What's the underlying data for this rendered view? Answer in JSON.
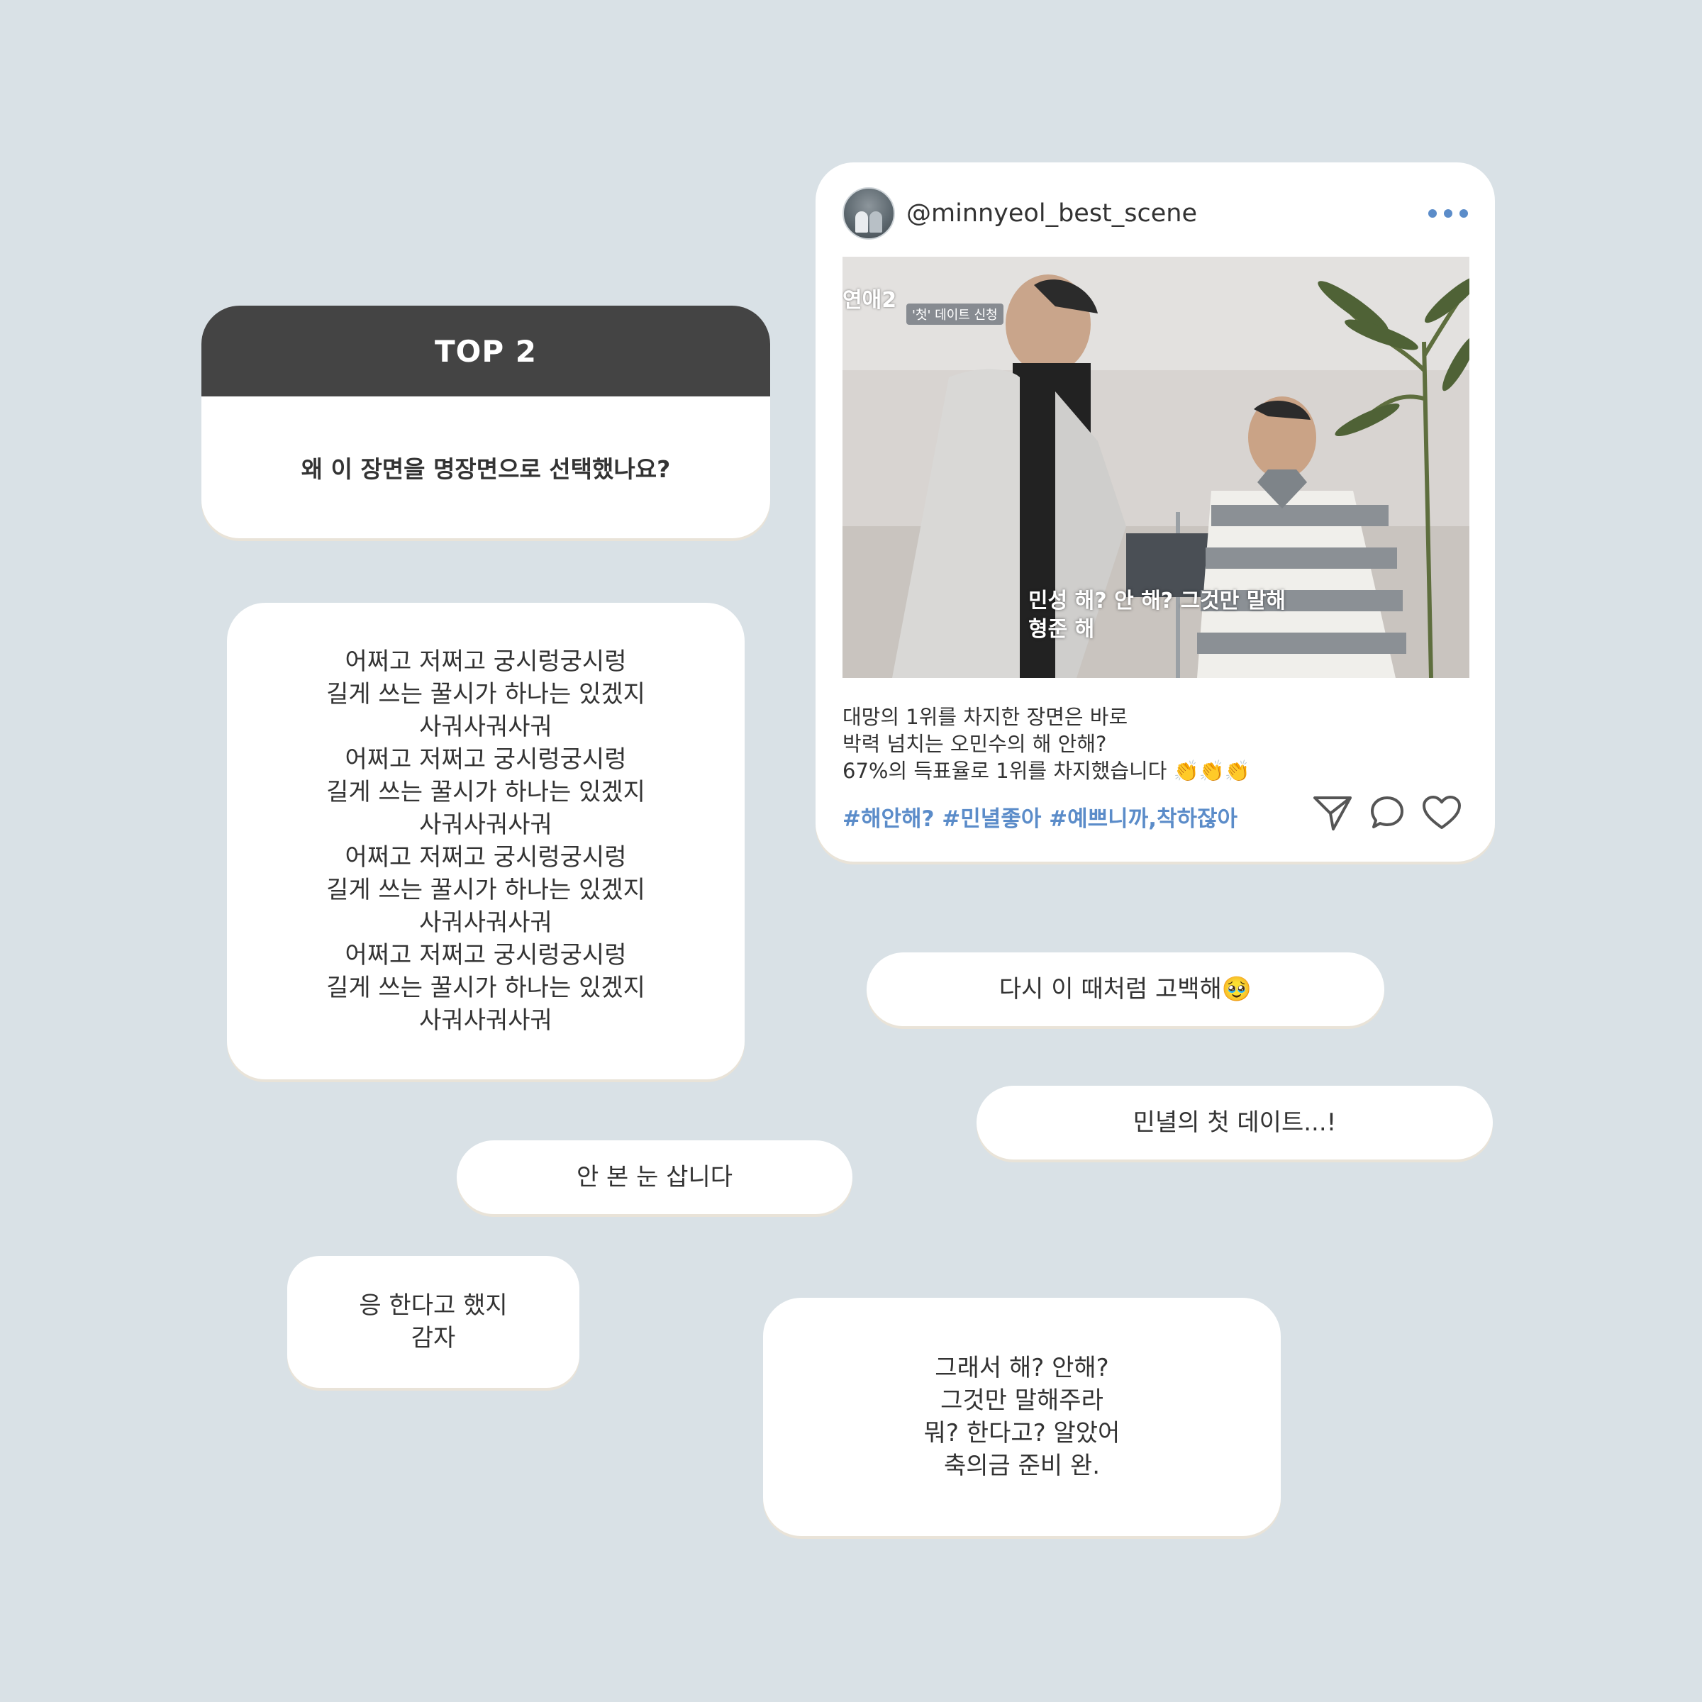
{
  "question_card": {
    "header": "TOP 2",
    "question": "왜 이 장면을 명장면으로 선택했나요?"
  },
  "post": {
    "username": "@minnyeol_best_scene",
    "more_icon": "more-dots-icon",
    "image": {
      "show_logo": "연애2",
      "show_tag": "'첫' 데이트 신청",
      "subtitle_line1": "민성 해? 안 해? 그것만 말해",
      "subtitle_line2": "형준 해"
    },
    "caption": [
      "대망의 1위를 차지한 장면은 바로",
      "박력 넘치는 오민수의 해 안해?",
      "67%의 득표율로 1위를 차지했습니다 👏👏👏"
    ],
    "hashtags": "#해안해? #민녈좋아 #예쁘니까,착하잖아",
    "actions": [
      "send-icon",
      "comment-icon",
      "heart-icon"
    ],
    "accent_color": "#5b8cc9"
  },
  "answers": {
    "long": [
      "어쩌고 저쩌고 궁시렁궁시렁",
      "길게 쓰는 꿀시가 하나는 있겠지",
      "사궈사궈사궈",
      "어쩌고 저쩌고 궁시렁궁시렁",
      "길게 쓰는 꿀시가 하나는 있겠지",
      "사궈사궈사궈",
      "어쩌고 저쩌고 궁시렁궁시렁",
      "길게 쓰는 꿀시가 하나는 있겠지",
      "사궈사궈사궈",
      "어쩌고 저쩌고 궁시렁궁시렁",
      "길게 쓰는 꿀시가 하나는 있겠지",
      "사궈사궈사궈"
    ],
    "a1": "다시 이 때처럼 고백해🥹",
    "a2": "민녈의 첫 데이트...!",
    "a3": "안 본 눈 삽니다",
    "a4": [
      "응 한다고 했지",
      "감자"
    ],
    "a5": [
      "그래서 해? 안해?",
      "그것만 말해주라",
      "뭐? 한다고? 알았어",
      "축의금 준비 완."
    ]
  }
}
